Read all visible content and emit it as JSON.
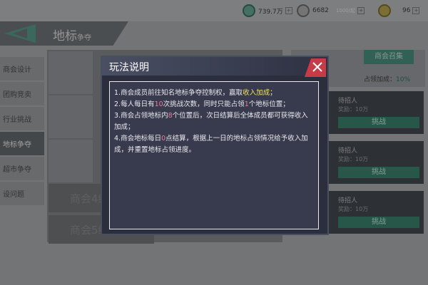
{
  "top_bar": {
    "resources": [
      {
        "icon": "green-currency-icon",
        "value": "739.7万"
      },
      {
        "icon": "silver-coin-icon",
        "value": "6682",
        "extra": "1000/起"
      },
      {
        "icon": "gold-coin-icon",
        "value": "96"
      }
    ]
  },
  "header": {
    "title": "地标",
    "title_suffix": "争夺"
  },
  "sidebar": {
    "items": [
      {
        "label": "商会设计"
      },
      {
        "label": "团购竞卖"
      },
      {
        "label": "行业挑战"
      },
      {
        "label": "地标争夺"
      },
      {
        "label": "超市争夺"
      },
      {
        "label": "设问题"
      }
    ]
  },
  "list": {
    "rows": [
      {
        "label": "商会4级"
      },
      {
        "label": "商会5级解锁"
      }
    ]
  },
  "right": {
    "guild_button": "商会召集",
    "bonus_label": "占领加成：",
    "bonus_value": "10%",
    "cards": [
      {
        "occupant": "待招人",
        "reward": "奖励：10万",
        "action": "挑战"
      },
      {
        "occupant": "待招人",
        "reward": "奖励：10万",
        "action": "挑战"
      },
      {
        "occupant": "待招人",
        "reward": "奖励：10万",
        "action": "挑战"
      }
    ]
  },
  "dialog": {
    "title": "玩法说明",
    "rules": [
      {
        "parts": [
          {
            "t": "1.商会成员前往知名地标争夺控制权，赢取"
          },
          {
            "t": "收入加成",
            "hl": "yellow"
          },
          {
            "t": "；"
          }
        ]
      },
      {
        "parts": [
          {
            "t": "2.每人每日有"
          },
          {
            "t": "10",
            "hl": "pink"
          },
          {
            "t": "次挑战次数，同时只能占领"
          },
          {
            "t": "1",
            "hl": "pink"
          },
          {
            "t": "个地标位置；"
          }
        ]
      },
      {
        "parts": [
          {
            "t": "3.商会占领地标内"
          },
          {
            "t": "8",
            "hl": "pink"
          },
          {
            "t": "个位置后，次日结算后全体成员都可获得收入加成；"
          }
        ]
      },
      {
        "parts": [
          {
            "t": "4.商会地标每日"
          },
          {
            "t": "0",
            "hl": "pink"
          },
          {
            "t": "点结算，根据上一日的地标占领情况给予收入加成，并重置地标占领进度。"
          }
        ]
      }
    ]
  }
}
